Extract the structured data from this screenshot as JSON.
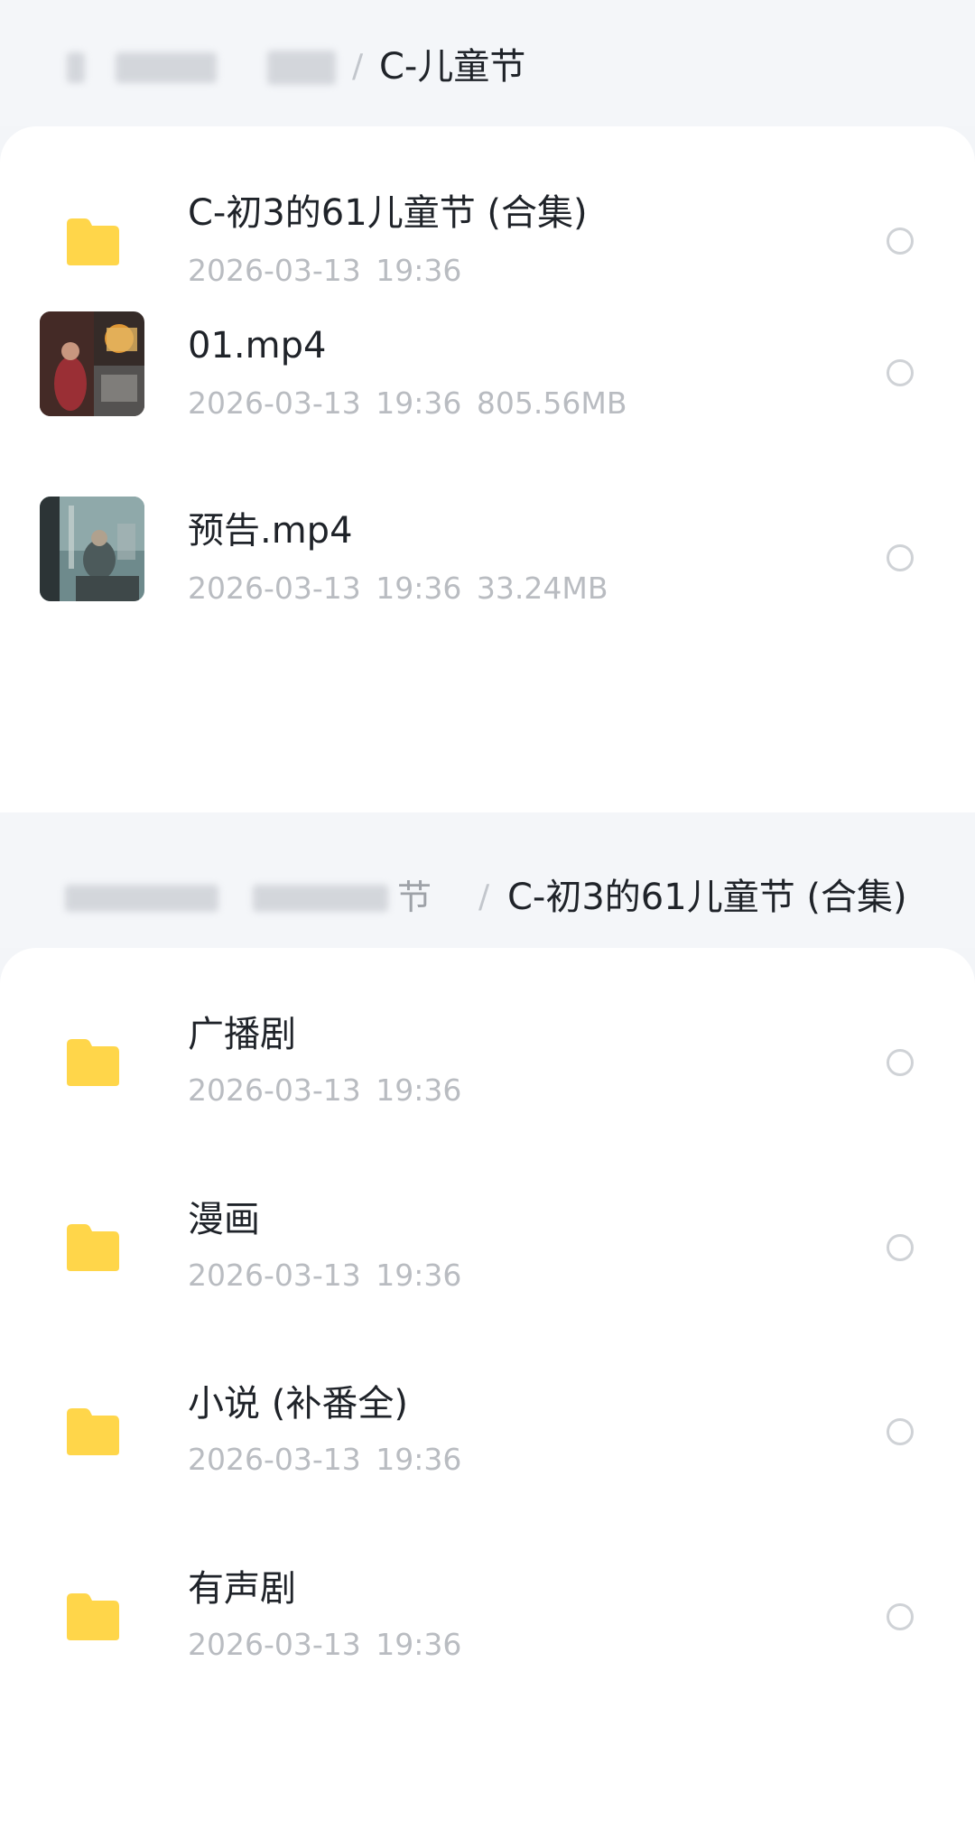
{
  "colors": {
    "folder": "#ffd64a",
    "title_text": "#1f2329",
    "meta_text": "#b9bcc1",
    "page_bg": "#f3f5f8",
    "card_bg": "#ffffff"
  },
  "panel1": {
    "breadcrumb": {
      "separator": "/",
      "current": "C-儿童节"
    },
    "items": [
      {
        "name": "C-初3的61儿童节 (合集)",
        "date": "2026-03-13",
        "time": "19:36",
        "size": "",
        "icon": "folder-icon"
      },
      {
        "name": "01.mp4",
        "date": "2026-03-13",
        "time": "19:36",
        "size": "805.56MB",
        "icon": "video-thumbnail"
      },
      {
        "name": "预告.mp4",
        "date": "2026-03-13",
        "time": "19:36",
        "size": "33.24MB",
        "icon": "video-thumbnail"
      }
    ]
  },
  "panel2": {
    "breadcrumb": {
      "partial": "节",
      "separator": "/",
      "current": "C-初3的61儿童节 (合集)"
    },
    "items": [
      {
        "name": "广播剧",
        "date": "2026-03-13",
        "time": "19:36",
        "icon": "folder-icon"
      },
      {
        "name": "漫画",
        "date": "2026-03-13",
        "time": "19:36",
        "icon": "folder-icon"
      },
      {
        "name": "小说 (补番全)",
        "date": "2026-03-13",
        "time": "19:36",
        "icon": "folder-icon"
      },
      {
        "name": "有声剧",
        "date": "2026-03-13",
        "time": "19:36",
        "icon": "folder-icon"
      }
    ]
  }
}
